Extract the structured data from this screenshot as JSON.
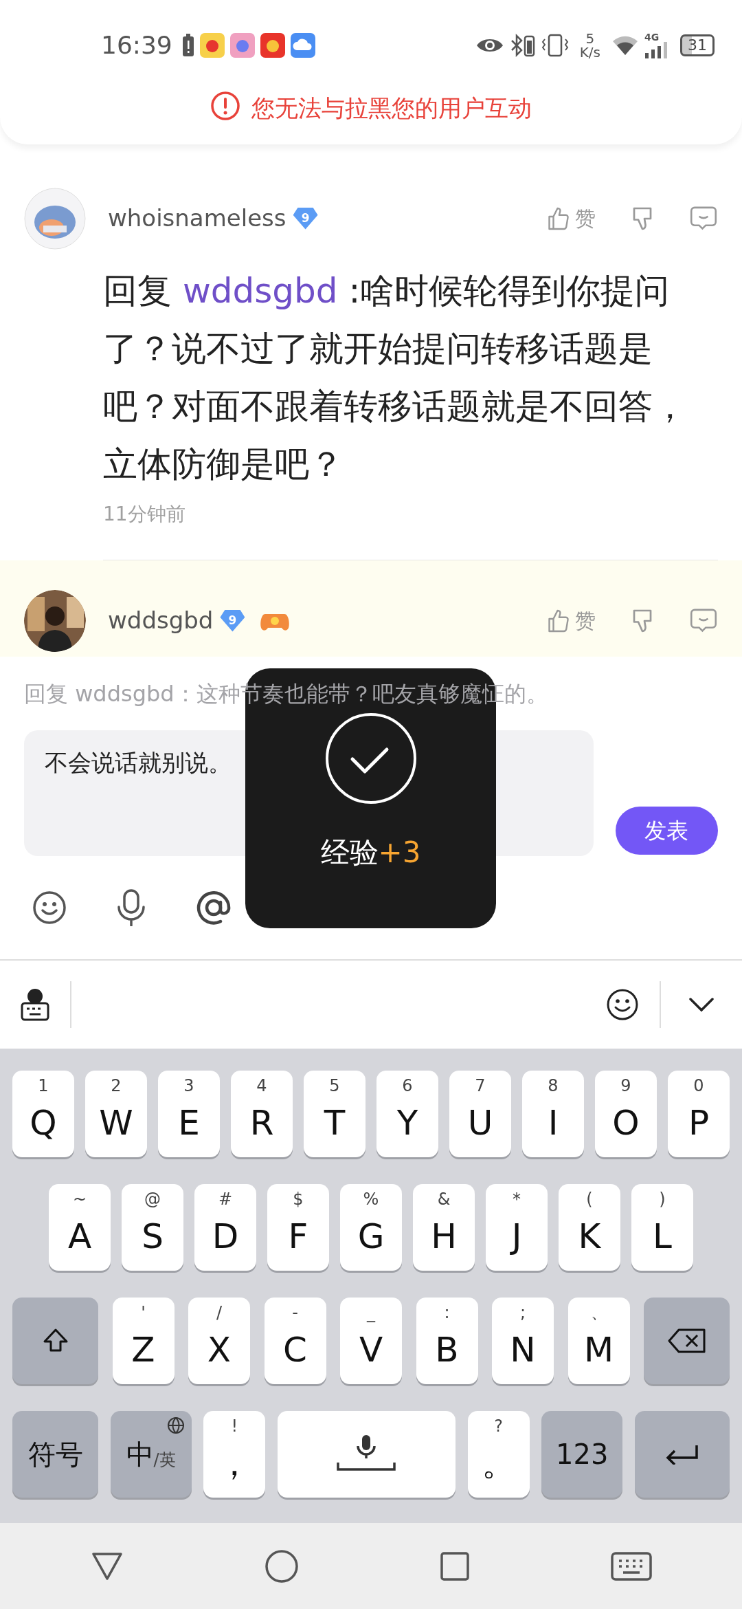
{
  "status_bar": {
    "time": "16:39",
    "net_speed_value": "5",
    "net_speed_unit": "K/s",
    "network_type": "4G",
    "battery": "31"
  },
  "alert": {
    "text": "您无法与拉黑您的用户互动"
  },
  "comments": [
    {
      "username": "whoisnameless",
      "level": "9",
      "has_game_badge": false,
      "highlighted": false,
      "like_label": "赞",
      "reply_prefix": "回复",
      "reply_to": "wddsgbd",
      "text": " :啥时候轮得到你提问了？说不过了就开始提问转移话题是吧？对面不跟着转移话题就是不回答，立体防御是吧？",
      "time": "11分钟前"
    },
    {
      "username": "wddsgbd",
      "level": "9",
      "has_game_badge": true,
      "highlighted": true,
      "like_label": "赞"
    }
  ],
  "reply_panel": {
    "hint": "回复 wddsgbd：这种节奏也能带？吧友真够魔怔的。",
    "input_value": "不会说话就别说。",
    "submit_label": "发表"
  },
  "toast": {
    "label": "经验",
    "bonus": "+3"
  },
  "keyboard": {
    "top_row": [
      {
        "kind": "char",
        "label": "Q",
        "hint": "1"
      },
      {
        "kind": "char",
        "label": "W",
        "hint": "2"
      },
      {
        "kind": "char",
        "label": "E",
        "hint": "3"
      },
      {
        "kind": "char",
        "label": "R",
        "hint": "4"
      },
      {
        "kind": "char",
        "label": "T",
        "hint": "5"
      },
      {
        "kind": "char",
        "label": "Y",
        "hint": "6"
      },
      {
        "kind": "char",
        "label": "U",
        "hint": "7"
      },
      {
        "kind": "char",
        "label": "I",
        "hint": "8"
      },
      {
        "kind": "char",
        "label": "O",
        "hint": "9"
      },
      {
        "kind": "char",
        "label": "P",
        "hint": "0"
      }
    ],
    "middle_row": [
      {
        "kind": "char",
        "label": "A",
        "hint": "~"
      },
      {
        "kind": "char",
        "label": "S",
        "hint": "@"
      },
      {
        "kind": "char",
        "label": "D",
        "hint": "#"
      },
      {
        "kind": "char",
        "label": "F",
        "hint": "$"
      },
      {
        "kind": "char",
        "label": "G",
        "hint": "%"
      },
      {
        "kind": "char",
        "label": "H",
        "hint": "&"
      },
      {
        "kind": "char",
        "label": "J",
        "hint": "*"
      },
      {
        "kind": "char",
        "label": "K",
        "hint": "("
      },
      {
        "kind": "char",
        "label": "L",
        "hint": ")"
      }
    ],
    "lower_row": [
      {
        "kind": "shift"
      },
      {
        "kind": "char",
        "label": "Z",
        "hint": "'"
      },
      {
        "kind": "char",
        "label": "X",
        "hint": "/"
      },
      {
        "kind": "char",
        "label": "C",
        "hint": "-"
      },
      {
        "kind": "char",
        "label": "V",
        "hint": "_"
      },
      {
        "kind": "char",
        "label": "B",
        "hint": ":"
      },
      {
        "kind": "char",
        "label": "N",
        "hint": ";"
      },
      {
        "kind": "char",
        "label": "M",
        "hint": "、"
      },
      {
        "kind": "backspace"
      }
    ],
    "bottom_row": [
      {
        "kind": "symbols",
        "label": "符号"
      },
      {
        "kind": "lang",
        "label": "中",
        "sub": "/英"
      },
      {
        "kind": "char",
        "label": "，",
        "hint": "!"
      },
      {
        "kind": "space"
      },
      {
        "kind": "char",
        "label": "。",
        "hint": "?"
      },
      {
        "kind": "num",
        "label": "123"
      },
      {
        "kind": "enter"
      }
    ]
  }
}
